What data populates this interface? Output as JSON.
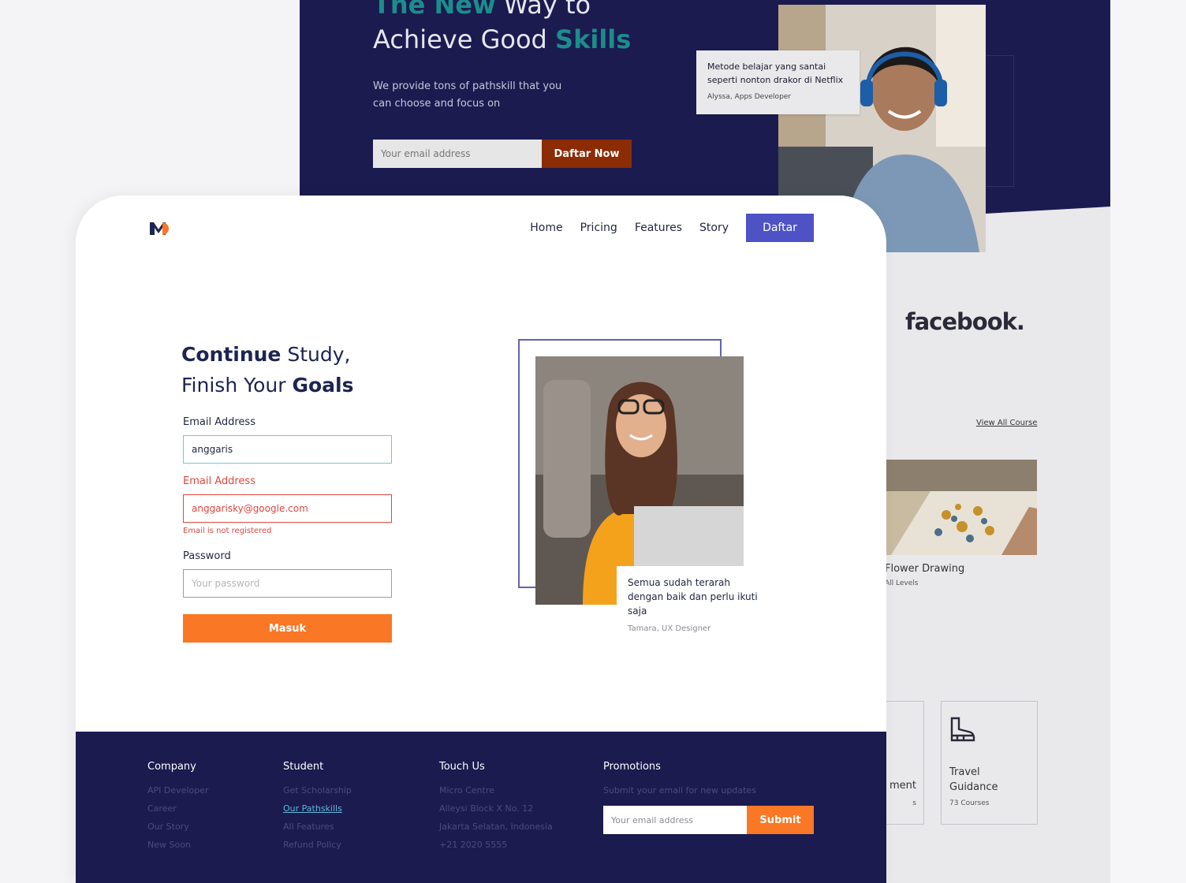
{
  "background_page": {
    "hero": {
      "title_line1_accent": "The New",
      "title_line1_rest": " Way to",
      "title_line2_rest": "Achieve Good ",
      "title_line2_accent": "Skills",
      "subtitle": "We provide tons of pathskill that you can choose and focus on",
      "email_placeholder": "Your email address",
      "cta_label": "Daftar Now",
      "quote_text": "Metode belajar yang santai seperti nonton drakor di Netflix",
      "quote_author": "Alyssa, Apps Developer"
    },
    "brand_logo_text": "facebook.",
    "view_all_label": "View All Course",
    "course": {
      "title": "Flower Drawing",
      "level": "All Levels"
    },
    "cards": [
      {
        "title": "ment",
        "count": "s"
      },
      {
        "title": "Travel Guidance",
        "count": "73 Courses",
        "icon": "boot-icon"
      }
    ]
  },
  "nav": {
    "items": [
      "Home",
      "Pricing",
      "Features",
      "Story"
    ],
    "cta_label": "Daftar"
  },
  "headline": {
    "part1_bold": "Continue",
    "part1_rest": " Study,",
    "part2_rest": "Finish Your ",
    "part2_bold": "Goals"
  },
  "form": {
    "email_label": "Email Address",
    "email_value": "anggaris",
    "email_error_label": "Email Address",
    "email_error_value": "anggarisky@google.com",
    "error_message": "Email is not registered",
    "password_label": "Password",
    "password_placeholder": "Your password",
    "submit_label": "Masuk"
  },
  "testimonial": {
    "text": "Semua sudah terarah dengan baik dan perlu ikuti saja",
    "author": "Tamara, UX Designer"
  },
  "footer": {
    "company": {
      "heading": "Company",
      "links": [
        "API Developer",
        "Career",
        "Our Story",
        "New Soon"
      ]
    },
    "student": {
      "heading": "Student",
      "links": [
        "Get Scholarship",
        "Our Pathskills",
        "All Features",
        "Refund Policy"
      ]
    },
    "touch": {
      "heading": "Touch Us",
      "lines": [
        "Micro Centre",
        "Alleysi Block X No. 12",
        "Jakarta Selatan, Indonesia",
        "+21 2020 5555"
      ]
    },
    "promotions": {
      "heading": "Promotions",
      "text": "Submit your email for new updates",
      "email_placeholder": "Your email address",
      "submit_label": "Submit"
    }
  },
  "colors": {
    "navy": "#1b1b50",
    "accent_orange": "#fa7725",
    "nav_cta": "#4f52c4",
    "error": "#e0463f",
    "teal": "#1d8c8c"
  }
}
